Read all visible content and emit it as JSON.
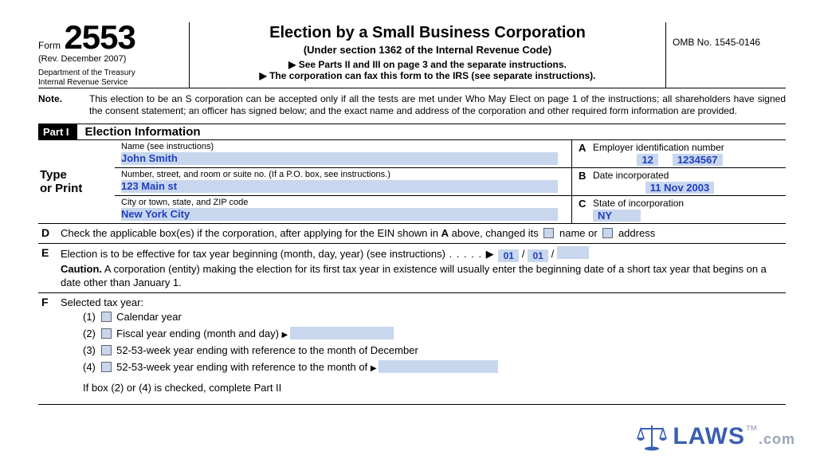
{
  "header": {
    "form_word": "Form",
    "form_number": "2553",
    "revision": "(Rev. December 2007)",
    "dept": "Department of the Treasury\nInternal Revenue Service",
    "title": "Election by a Small Business Corporation",
    "subtitle": "(Under section 1362 of the Internal Revenue Code)",
    "see": "See Parts II and III on page 3 and the separate instructions.",
    "fax": "The corporation can fax this form to the IRS (see separate instructions).",
    "omb": "OMB No. 1545-0146"
  },
  "note": {
    "label": "Note.",
    "text": "This election to be an S corporation can be accepted only if all the tests are met under Who May Elect on page 1 of the instructions; all shareholders have signed the consent statement; an officer has signed below; and the exact name and address of the corporation and other required form information are provided."
  },
  "part": {
    "tag": "Part I",
    "title": "Election Information"
  },
  "type_or_print": "Type\nor Print",
  "fields": {
    "name_lbl": "Name (see instructions)",
    "name_val": "John Smith",
    "addr_lbl": "Number, street, and room or suite no. (If a P.O. box, see instructions.)",
    "addr_val": "123 Main st",
    "city_lbl": "City or town, state, and ZIP code",
    "city_val": "New York City",
    "A_lbl": "Employer identification number",
    "A_letter": "A",
    "ein_a": "12",
    "ein_b": "1234567",
    "B_lbl": "Date incorporated",
    "B_letter": "B",
    "B_val": "11 Nov 2003",
    "C_lbl": "State of incorporation",
    "C_letter": "C",
    "C_val": "NY"
  },
  "D": {
    "letter": "D",
    "text_a": "Check the applicable box(es) if the corporation, after applying for the EIN shown in ",
    "bold_a": "A",
    "text_b": " above, changed its ",
    "opt1": " name or ",
    "opt2": " address"
  },
  "E": {
    "letter": "E",
    "text": "Election is to be effective for tax year beginning (month, day, year) (see instructions)",
    "month": "01",
    "day": "01",
    "caution_lbl": "Caution.",
    "caution": " A corporation (entity) making the election for its first tax year in existence will usually enter the beginning date of a short tax year that begins on a date other than January 1."
  },
  "F": {
    "letter": "F",
    "head": "Selected tax year:",
    "o1": "Calendar year",
    "o2": "Fiscal year ending (month and day) ",
    "o3": "52-53-week year ending with reference to the month of December",
    "o4": "52-53-week year ending with reference to the month of ",
    "tail": "If box (2) or (4) is checked, complete Part II"
  },
  "watermark": {
    "brand": "LAWS",
    "suffix": ".com",
    "tm": "™"
  }
}
